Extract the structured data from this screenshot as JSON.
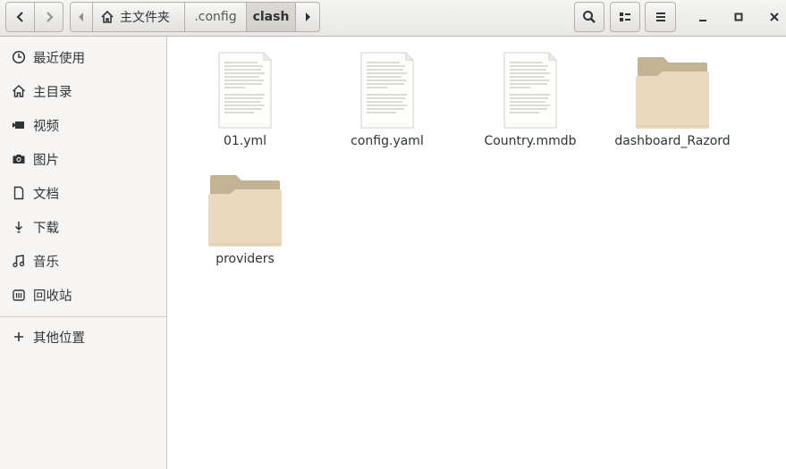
{
  "path": {
    "home_label": "主文件夹",
    "segments": [
      ".config",
      "clash"
    ]
  },
  "sidebar": {
    "items": [
      {
        "label": "最近使用",
        "icon": "clock-icon"
      },
      {
        "label": "主目录",
        "icon": "home-icon"
      },
      {
        "label": "视频",
        "icon": "video-icon"
      },
      {
        "label": "图片",
        "icon": "camera-icon"
      },
      {
        "label": "文档",
        "icon": "document-icon"
      },
      {
        "label": "下载",
        "icon": "download-icon"
      },
      {
        "label": "音乐",
        "icon": "music-icon"
      },
      {
        "label": "回收站",
        "icon": "trash-icon"
      }
    ],
    "other": {
      "label": "其他位置",
      "icon": "plus-icon"
    }
  },
  "files": [
    {
      "name": "01.yml",
      "type": "document"
    },
    {
      "name": "config.yaml",
      "type": "document"
    },
    {
      "name": "Country.mmdb",
      "type": "document"
    },
    {
      "name": "dashboard_Razord",
      "type": "folder"
    },
    {
      "name": "providers",
      "type": "folder"
    }
  ],
  "colors": {
    "folder_front": "#ead9bf",
    "folder_back": "#c3b293",
    "sidebar_bg": "#f6f5f4"
  }
}
